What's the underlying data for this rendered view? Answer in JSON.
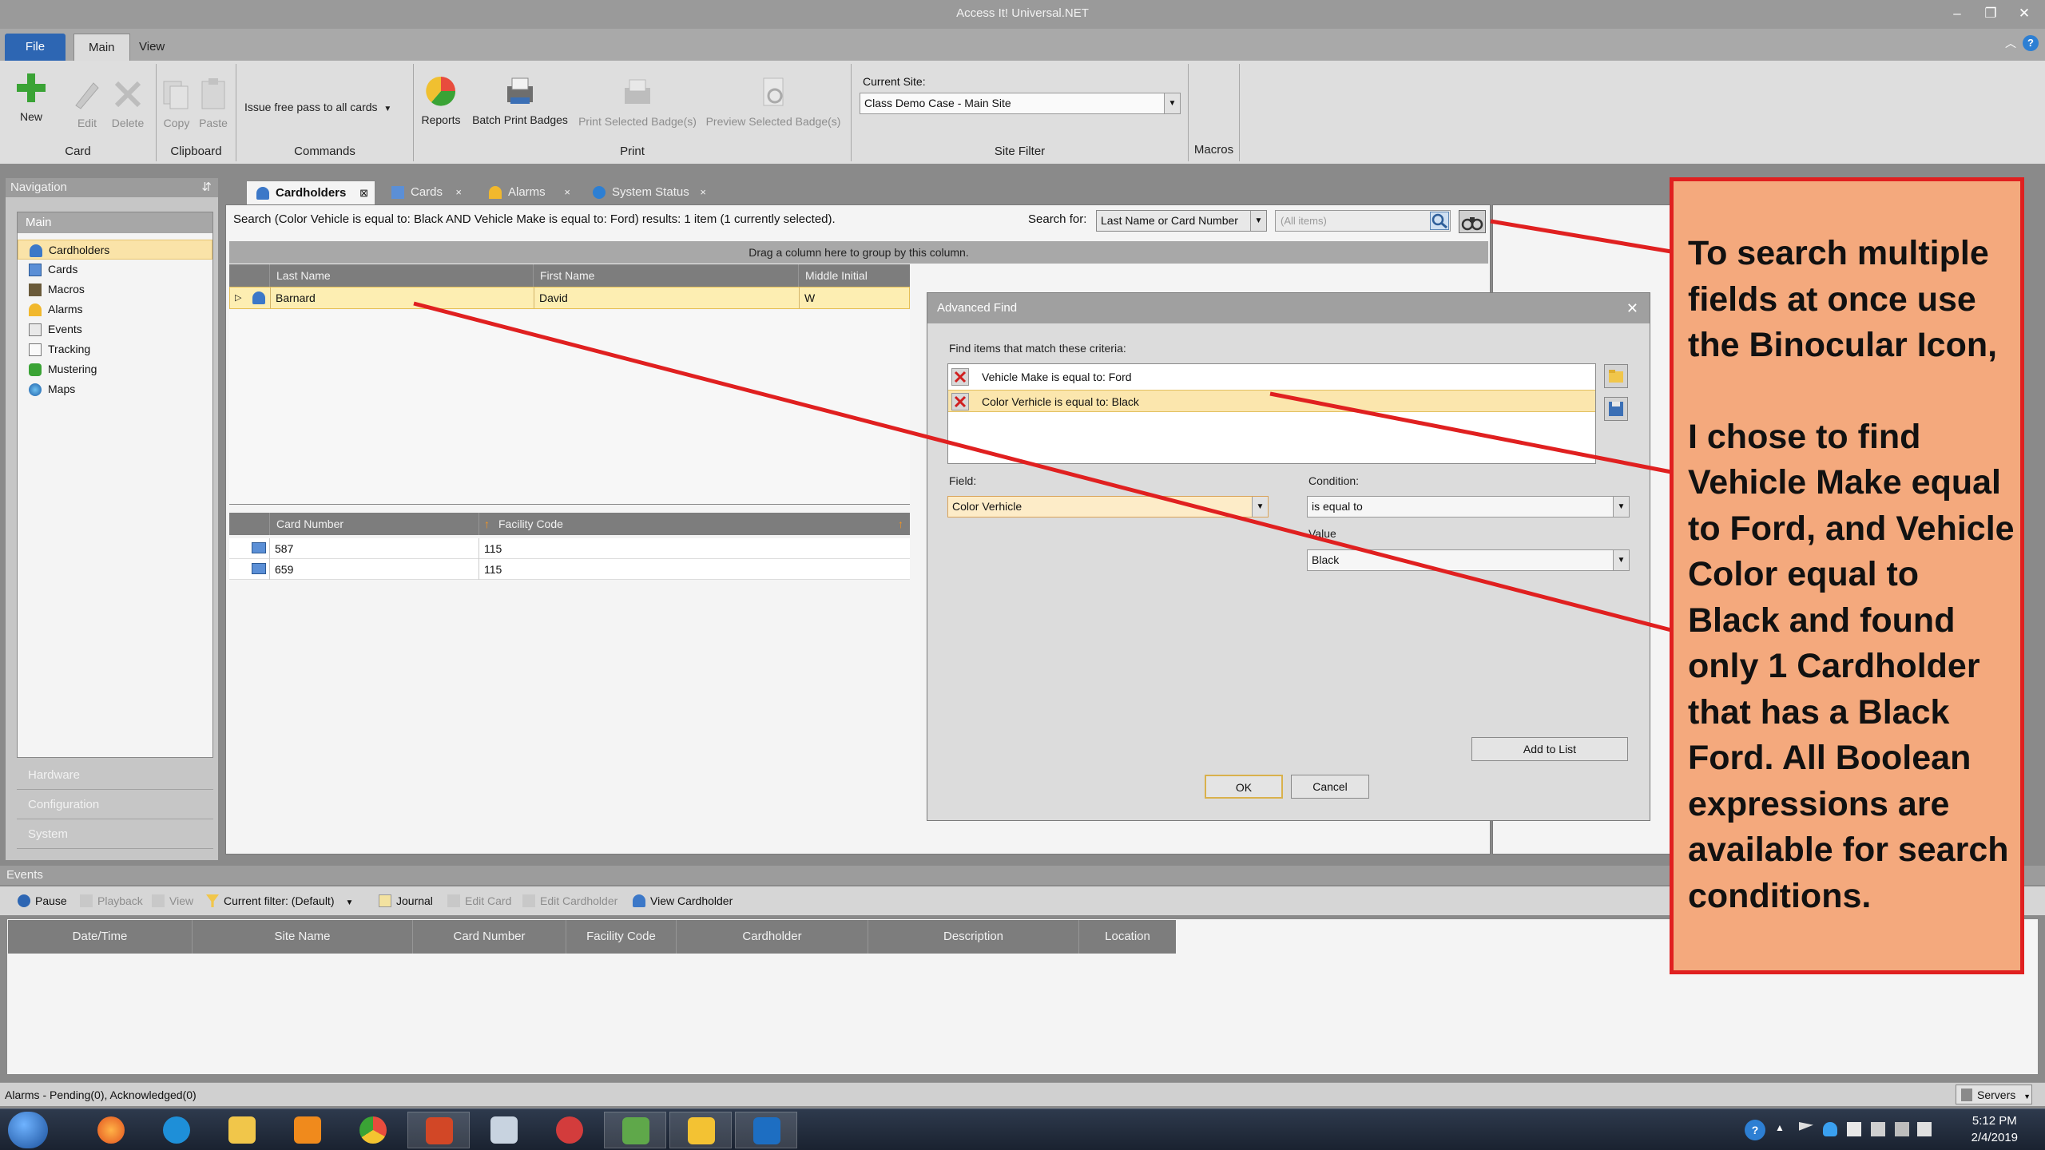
{
  "window": {
    "title": "Access It! Universal.NET",
    "minimize": "–",
    "restore": "❐",
    "close": "✕"
  },
  "ribbon_tabs": [
    {
      "label": "File"
    },
    {
      "label": "Main"
    },
    {
      "label": "View"
    }
  ],
  "ribbon": {
    "card_group": "Card",
    "new": "New",
    "edit": "Edit",
    "delete": "Delete",
    "clipboard_group": "Clipboard",
    "copy": "Copy",
    "paste": "Paste",
    "commands_group": "Commands",
    "issue_free_pass": "Issue free pass to all cards",
    "print_group": "Print",
    "reports": "Reports",
    "batch_print": "Batch Print Badges",
    "print_selected": "Print Selected Badge(s)",
    "preview_selected": "Preview Selected Badge(s)",
    "site_filter_group": "Site Filter",
    "current_site_label": "Current Site:",
    "current_site_value": "Class Demo Case - Main Site",
    "macros_group": "Macros"
  },
  "navigation": {
    "title": "Navigation",
    "main_label": "Main",
    "items": [
      {
        "label": "Cardholders",
        "icon": "cardholder-icon"
      },
      {
        "label": "Cards",
        "icon": "card-icon"
      },
      {
        "label": "Macros",
        "icon": "macro-icon"
      },
      {
        "label": "Alarms",
        "icon": "alarm-icon"
      },
      {
        "label": "Events",
        "icon": "event-icon"
      },
      {
        "label": "Tracking",
        "icon": "tracking-icon"
      },
      {
        "label": "Mustering",
        "icon": "mustering-icon"
      },
      {
        "label": "Maps",
        "icon": "globe-icon"
      }
    ],
    "sections": [
      "Hardware",
      "Configuration",
      "System"
    ]
  },
  "doc_tabs": [
    {
      "label": "Cardholders",
      "close": "⊠"
    },
    {
      "label": "Cards",
      "close": "×"
    },
    {
      "label": "Alarms",
      "close": "×"
    },
    {
      "label": "System Status",
      "close": "×"
    }
  ],
  "search": {
    "summary": "Search (Color Vehicle is equal to: Black AND Vehicle Make is equal to: Ford) results: 1 item (1 currently selected).",
    "search_for_label": "Search for:",
    "search_field": "Last Name or Card Number",
    "search_input_placeholder": "(All items)"
  },
  "group_bar": "Drag a column here to group by this column.",
  "cardholder_grid": {
    "columns": [
      "Last Name",
      "First Name",
      "Middle Initial"
    ],
    "rows": [
      {
        "indicator": "▷",
        "last": "Barnard",
        "first": "David",
        "middle": "W"
      }
    ]
  },
  "card_grid": {
    "columns": [
      "Card Number",
      "Facility Code"
    ],
    "rows": [
      {
        "card": "587",
        "facility": "115"
      },
      {
        "card": "659",
        "facility": "115"
      }
    ]
  },
  "advanced_find": {
    "title": "Advanced Find",
    "close": "✕",
    "criteria_label": "Find items that match these criteria:",
    "criteria": [
      "Vehicle Make is equal to: Ford",
      "Color Verhicle is equal to: Black"
    ],
    "field_label": "Field:",
    "field_value": "Color Verhicle",
    "condition_label": "Condition:",
    "condition_value": "is equal to",
    "value_label": "Value",
    "value_value": "Black",
    "add_to_list": "Add to List",
    "ok": "OK",
    "cancel": "Cancel"
  },
  "events": {
    "title": "Events",
    "toolbar": {
      "pause": "Pause",
      "playback": "Playback",
      "view": "View",
      "current_filter": "Current filter:  (Default)",
      "journal": "Journal",
      "edit_card": "Edit Card",
      "edit_cardholder": "Edit Cardholder",
      "view_cardholder": "View Cardholder"
    },
    "columns": [
      "Date/Time",
      "Site Name",
      "Card Number",
      "Facility Code",
      "Cardholder",
      "Description",
      "Location"
    ]
  },
  "status": {
    "alarms": "Alarms - Pending(0), Acknowledged(0)",
    "servers": "Servers"
  },
  "taskbar": {
    "time": "5:12 PM",
    "date": "2/4/2019",
    "help": "?"
  },
  "callout": {
    "para1": "To search multiple fields at once use the Binocular Icon,",
    "para2": "I chose to find Vehicle Make equal to Ford, and Vehicle Color equal to Black and found only 1 Cardholder that has a Black Ford. All Boolean expressions are available for search conditions."
  },
  "colors": {
    "annotation_red": "#e02020",
    "callout_fill": "#f4a97d",
    "file_tab_blue": "#2d66b3",
    "selection": "#fdeeb2"
  }
}
